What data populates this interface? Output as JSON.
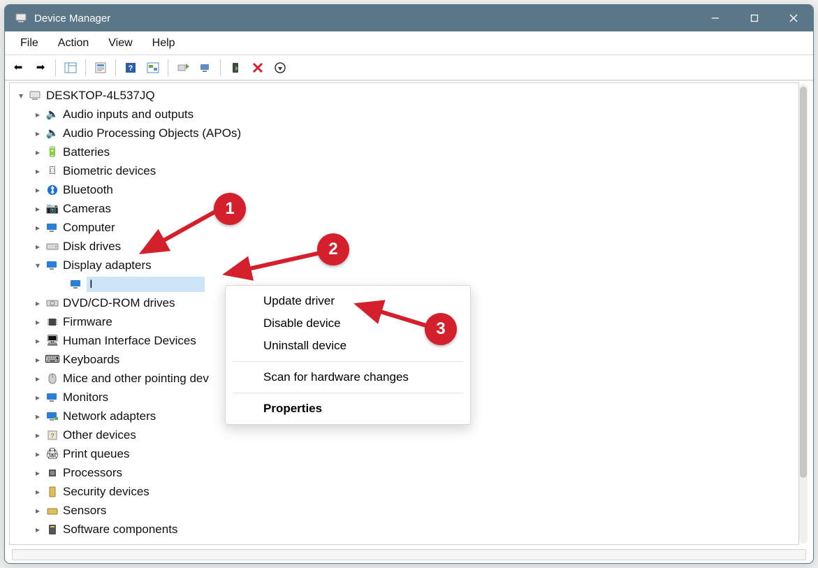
{
  "window": {
    "title": "Device Manager"
  },
  "menus": {
    "file": "File",
    "action": "Action",
    "view": "View",
    "help": "Help"
  },
  "tree": {
    "root": "DESKTOP-4L537JQ",
    "categories": [
      "Audio inputs and outputs",
      "Audio Processing Objects (APOs)",
      "Batteries",
      "Biometric devices",
      "Bluetooth",
      "Cameras",
      "Computer",
      "Disk drives",
      "Display adapters",
      "DVD/CD-ROM drives",
      "Firmware",
      "Human Interface Devices",
      "Keyboards",
      "Mice and other pointing dev",
      "Monitors",
      "Network adapters",
      "Other devices",
      "Print queues",
      "Processors",
      "Security devices",
      "Sensors",
      "Software components"
    ],
    "selected_device_prefix": "I"
  },
  "context_menu": {
    "update": "Update driver",
    "disable": "Disable device",
    "uninstall": "Uninstall device",
    "scan": "Scan for hardware changes",
    "properties": "Properties"
  },
  "annotations": {
    "b1": "1",
    "b2": "2",
    "b3": "3"
  }
}
